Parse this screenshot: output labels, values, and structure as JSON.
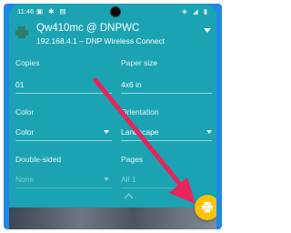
{
  "status": {
    "time": "11:46",
    "left_icons": "▣ ✱ ▤",
    "right_icons": "◈ ◢ ▮"
  },
  "header": {
    "title": "Qw410mc @ DNPWC",
    "subtitle": "192.168.4.1 – DNP Wireless Connect"
  },
  "settings": {
    "copies": {
      "label": "Copies",
      "value": "01"
    },
    "paper_size": {
      "label": "Paper size",
      "value": "4x6 in"
    },
    "color": {
      "label": "Color",
      "value": "Color"
    },
    "orientation": {
      "label": "Orientation",
      "value": "Landscape"
    },
    "double_sided": {
      "label": "Double-sided",
      "value": "None"
    },
    "pages": {
      "label": "Pages",
      "value": "All 1"
    }
  },
  "colors": {
    "accent": "#1ba3b3",
    "frame": "#1e88e5",
    "fab": "#ffc107",
    "arrow": "#e8245a"
  },
  "icons": {
    "printer": "printer-icon",
    "fab": "print-icon"
  }
}
